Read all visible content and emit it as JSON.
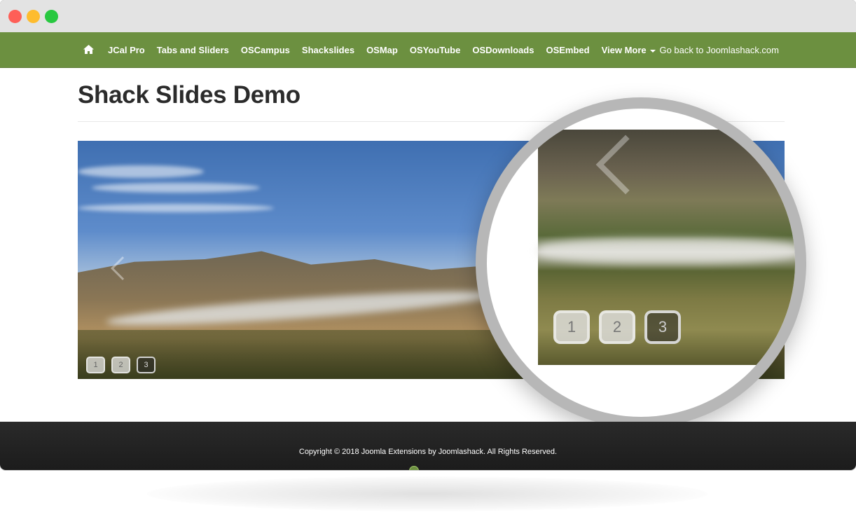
{
  "window": {
    "controls": [
      "close",
      "minimize",
      "maximize"
    ]
  },
  "nav": {
    "home_icon": "home-icon",
    "items": [
      {
        "label": "JCal Pro"
      },
      {
        "label": "Tabs and Sliders"
      },
      {
        "label": "OSCampus"
      },
      {
        "label": "Shackslides"
      },
      {
        "label": "OSMap"
      },
      {
        "label": "OSYouTube"
      },
      {
        "label": "OSDownloads"
      },
      {
        "label": "OSEmbed"
      }
    ],
    "dropdown_label": "View More",
    "right_link": "Go back to Joomlashack.com",
    "background": "#6c9040"
  },
  "page": {
    "title": "Shack Slides Demo"
  },
  "slider": {
    "pager": [
      "1",
      "2",
      "3"
    ],
    "active_index": 2,
    "magnified_pager": [
      "1",
      "2",
      "3"
    ]
  },
  "footer": {
    "copyright": "Copyright © 2018 Joomla Extensions by Joomlashack. All Rights Reserved."
  }
}
